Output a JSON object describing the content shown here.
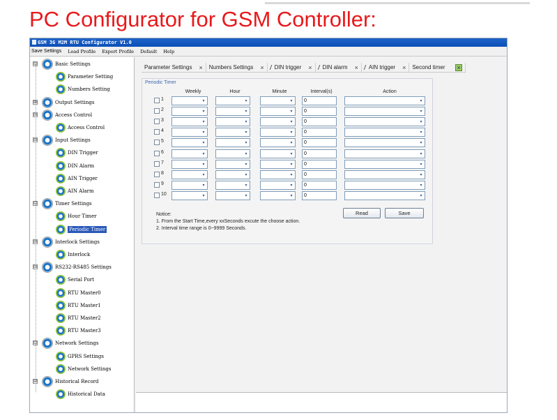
{
  "headline": "PC Configurator for GSM Controller:",
  "window": {
    "title": "GSM 3G M2M RTU Configurator V1.0"
  },
  "menu": [
    "Save Settings",
    "Load Profile",
    "Export Profile",
    "Default",
    "Help"
  ],
  "tree": [
    {
      "label": "Basic Settings",
      "level": 0,
      "expander": "⊟"
    },
    {
      "label": "Parameter Setting",
      "level": 1
    },
    {
      "label": "Numbers Setting",
      "level": 1
    },
    {
      "label": "Output Settings",
      "level": 0,
      "expander": "⊞"
    },
    {
      "label": "Access Control",
      "level": 0,
      "expander": "⊟"
    },
    {
      "label": "Access Control",
      "level": 1
    },
    {
      "label": "Input Settings",
      "level": 0,
      "expander": "⊟"
    },
    {
      "label": "DIN Trigger",
      "level": 1
    },
    {
      "label": "DIN Alarm",
      "level": 1
    },
    {
      "label": "AIN Trigger",
      "level": 1
    },
    {
      "label": "AIN Alarm",
      "level": 1
    },
    {
      "label": "Timer Settings",
      "level": 0,
      "expander": "⊟"
    },
    {
      "label": "Hour Timer",
      "level": 1
    },
    {
      "label": "Periodic Timer",
      "level": 1,
      "selected": true
    },
    {
      "label": "Interlock Settings",
      "level": 0,
      "expander": "⊟"
    },
    {
      "label": "Interlock",
      "level": 1
    },
    {
      "label": "RS232-RS485 Settings",
      "level": 0,
      "expander": "⊟"
    },
    {
      "label": "Serial Port",
      "level": 1
    },
    {
      "label": "RTU Master0",
      "level": 1
    },
    {
      "label": "RTU Master1",
      "level": 1
    },
    {
      "label": "RTU Master2",
      "level": 1
    },
    {
      "label": "RTU Master3",
      "level": 1
    },
    {
      "label": "Network Settings",
      "level": 0,
      "expander": "⊟"
    },
    {
      "label": "GPRS Settings",
      "level": 1
    },
    {
      "label": "Network Settings",
      "level": 1
    },
    {
      "label": "Historical Record",
      "level": 0,
      "expander": "⊟"
    },
    {
      "label": "Historical Data",
      "level": 1
    }
  ],
  "tabs": [
    {
      "label": "Parameter Settings",
      "close": "×"
    },
    {
      "label": "Numbers Settings",
      "close": "×"
    },
    {
      "label": "DIN trigger",
      "close": "×",
      "pin": true
    },
    {
      "label": "DIN alarm",
      "close": "×",
      "pin": true
    },
    {
      "label": "AIN trigger",
      "close": "×",
      "pin": true
    },
    {
      "label": "Second timer",
      "close": "×",
      "active": true
    }
  ],
  "periodic_timer": {
    "title": "Periodic Timer",
    "columns": [
      "Weekly",
      "Hour",
      "Minute",
      "Interval(s)",
      "Action"
    ],
    "rows": [
      {
        "num": "1",
        "interval": "0"
      },
      {
        "num": "2",
        "interval": "0"
      },
      {
        "num": "3",
        "interval": "0"
      },
      {
        "num": "4",
        "interval": "0"
      },
      {
        "num": "5",
        "interval": "0"
      },
      {
        "num": "6",
        "interval": "0"
      },
      {
        "num": "7",
        "interval": "0"
      },
      {
        "num": "8",
        "interval": "0"
      },
      {
        "num": "9",
        "interval": "0"
      },
      {
        "num": "10",
        "interval": "0"
      }
    ],
    "notice_title": "Notice:",
    "notice_lines": [
      "1. From the Start Time,every xxSeconds excute the choose action.",
      "2. Interval time range is 0~9999 Seconds."
    ],
    "read_label": "Read",
    "save_label": "Save"
  },
  "icons": {
    "dropdown": "chevron-down-icon",
    "tree_node": "gear-icon"
  }
}
